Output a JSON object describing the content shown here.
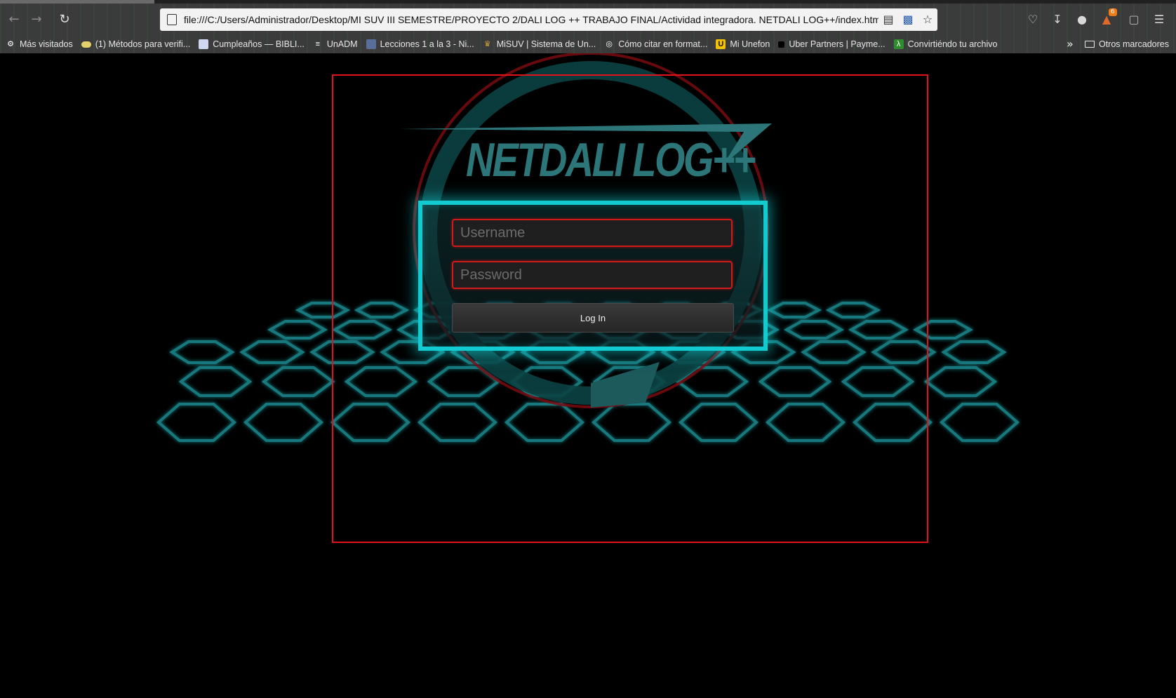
{
  "browser": {
    "url": "file:///C:/Users/Administrador/Desktop/MI SUV III SEMESTRE/PROYECTO 2/DALI LOG ++ TRABAJO FINAL/Actividad integradora. NETDALI LOG++/index.html",
    "notification_count": "6",
    "bookmarks": [
      {
        "label": "Más visitados",
        "icon": "gear-icon"
      },
      {
        "label": "(1) Métodos para verifi...",
        "icon": "pill-icon"
      },
      {
        "label": "Cumpleaños — BIBLI...",
        "icon": "doc-icon"
      },
      {
        "label": "UnADM",
        "icon": "unadm-icon"
      },
      {
        "label": "Lecciones 1 a la 3 - Ni...",
        "icon": "avatar-icon"
      },
      {
        "label": "MiSUV | Sistema de Un...",
        "icon": "crest-icon"
      },
      {
        "label": "Cómo citar en format...",
        "icon": "globe-icon"
      },
      {
        "label": "Mi Unefon",
        "icon": "unefon-icon"
      },
      {
        "label": "Uber Partners | Payme...",
        "icon": "uber-icon"
      },
      {
        "label": "Convirtiéndo tu archivo",
        "icon": "lambda-icon"
      }
    ],
    "other_bookmarks": "Otros marcadores"
  },
  "page": {
    "brand": "NETDALI LOG++",
    "username_placeholder": "Username",
    "password_placeholder": "Password",
    "login_label": "Log In"
  }
}
